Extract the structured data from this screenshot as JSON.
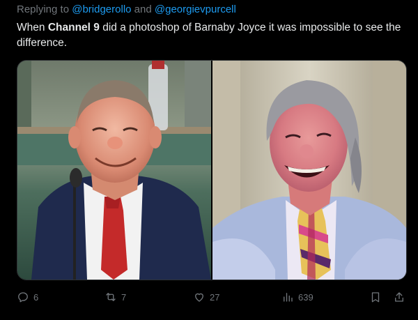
{
  "reply": {
    "prefix": "Replying to",
    "handle_1": "@bridgerollo",
    "conjunction": "and",
    "handle_2": "@georgievpurcell"
  },
  "tweet": {
    "text_1": "When ",
    "text_bold": "Channel 9",
    "text_2": " did a photoshop of Barnaby Joyce it was impossible to see the difference."
  },
  "actions": {
    "replies": "6",
    "reposts": "7",
    "likes": "27",
    "views": "639"
  },
  "icons": {
    "reply": "reply-icon",
    "repost": "repost-icon",
    "like": "heart-icon",
    "views": "views-chart-icon",
    "bookmark": "bookmark-icon",
    "share": "share-icon"
  },
  "colors": {
    "background": "#000000",
    "text": "#e7e9ea",
    "muted": "#71767b",
    "link": "#1d9bf0"
  }
}
